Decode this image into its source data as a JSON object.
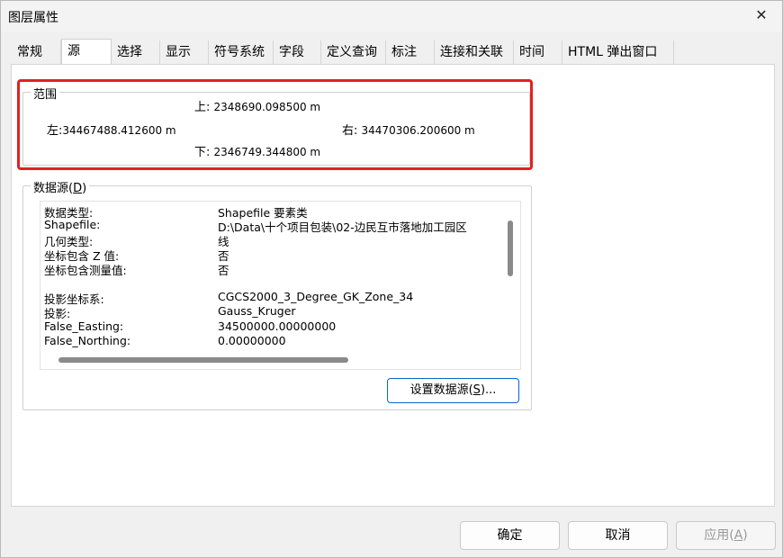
{
  "window": {
    "title": "图层属性",
    "close_glyph": "✕"
  },
  "tabs": [
    {
      "label": "常规"
    },
    {
      "label": "源"
    },
    {
      "label": "选择"
    },
    {
      "label": "显示"
    },
    {
      "label": "符号系统"
    },
    {
      "label": "字段"
    },
    {
      "label": "定义查询"
    },
    {
      "label": "标注"
    },
    {
      "label": "连接和关联"
    },
    {
      "label": "时间"
    },
    {
      "label": "HTML 弹出窗口"
    }
  ],
  "extent": {
    "title": "范围",
    "top_label": "上:",
    "top_value": "2348690.098500 m",
    "left_label": "左:",
    "left_value": "34467488.412600 m",
    "right_label": "右:",
    "right_value": "34470306.200600 m",
    "bottom_label": "下:",
    "bottom_value": "2346749.344800 m"
  },
  "datasource": {
    "title": "数据源",
    "title_key": "D",
    "rows": [
      {
        "key": "数据类型:",
        "value": "Shapefile 要素类"
      },
      {
        "key": "Shapefile:",
        "value": "D:\\Data\\十个项目包装\\02-边民互市落地加工园区"
      },
      {
        "key": "几何类型:",
        "value": "线"
      },
      {
        "key": "坐标包含 Z 值:",
        "value": "否"
      },
      {
        "key": "坐标包含测量值:",
        "value": "否"
      },
      {
        "key": "",
        "value": ""
      },
      {
        "key": "投影坐标系:",
        "value": "CGCS2000_3_Degree_GK_Zone_34"
      },
      {
        "key": "投影:",
        "value": "Gauss_Kruger"
      },
      {
        "key": "False_Easting:",
        "value": "34500000.00000000"
      },
      {
        "key": "False_Northing:",
        "value": "0.00000000"
      }
    ],
    "set_source_label": "设置数据源(",
    "set_source_key": "S",
    "set_source_suffix": ")..."
  },
  "footer": {
    "ok_label": "确定",
    "cancel_label": "取消",
    "apply_label": "应用(",
    "apply_key": "A",
    "apply_suffix": ")"
  },
  "colors": {
    "highlight": "#e12121",
    "focus": "#0a64c8"
  }
}
